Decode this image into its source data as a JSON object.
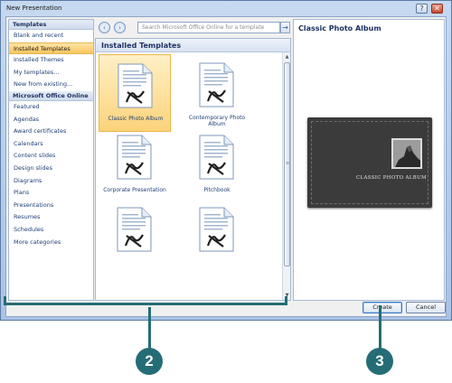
{
  "window": {
    "title": "New Presentation",
    "minimize": "?",
    "close": "✕"
  },
  "left_pane": {
    "sections": [
      {
        "header": "Templates",
        "items": [
          {
            "label": "Blank and recent",
            "selected": false
          },
          {
            "label": "Installed Templates",
            "selected": true
          },
          {
            "label": "Installed Themes",
            "selected": false
          },
          {
            "label": "My templates...",
            "selected": false
          },
          {
            "label": "New from existing...",
            "selected": false
          }
        ]
      },
      {
        "header": "Microsoft Office Online",
        "items": [
          {
            "label": "Featured",
            "selected": false
          },
          {
            "label": "Agendas",
            "selected": false
          },
          {
            "label": "Award certificates",
            "selected": false
          },
          {
            "label": "Calendars",
            "selected": false
          },
          {
            "label": "Content slides",
            "selected": false
          },
          {
            "label": "Design slides",
            "selected": false
          },
          {
            "label": "Diagrams",
            "selected": false
          },
          {
            "label": "Plans",
            "selected": false
          },
          {
            "label": "Presentations",
            "selected": false
          },
          {
            "label": "Resumes",
            "selected": false
          },
          {
            "label": "Schedules",
            "selected": false
          },
          {
            "label": "More categories",
            "selected": false
          }
        ]
      }
    ]
  },
  "search": {
    "placeholder": "Search Microsoft Office Online for a template",
    "back": "‹",
    "forward": "›",
    "go": "→"
  },
  "gallery": {
    "header": "Installed Templates",
    "tiles": [
      {
        "label": "Classic Photo Album",
        "selected": true
      },
      {
        "label": "Contemporary Photo Album",
        "selected": false
      },
      {
        "label": "Corporate Presentation",
        "selected": false
      },
      {
        "label": "Pitchbook",
        "selected": false
      },
      {
        "label": "",
        "selected": false
      },
      {
        "label": "",
        "selected": false
      }
    ]
  },
  "preview": {
    "title": "Classic Photo Album",
    "album_text": "CLASSIC PHOTO ALBUM"
  },
  "buttons": {
    "create": "Create",
    "cancel": "Cancel"
  },
  "callouts": {
    "left": "2",
    "right": "3"
  },
  "colors": {
    "accent": "#256d76",
    "selection": "#fcd37a"
  }
}
